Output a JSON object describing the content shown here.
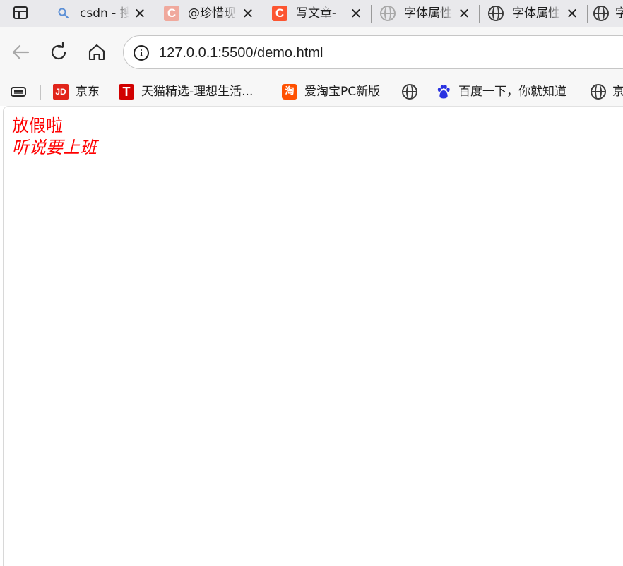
{
  "tabs": [
    {
      "title": "csdn - 搜",
      "icon": "search-icon",
      "close": "✕"
    },
    {
      "title": "@珍惜现",
      "icon": "csdn-icon",
      "close": "✕"
    },
    {
      "title": "写文章-",
      "icon": "csdn-icon",
      "close": "✕"
    },
    {
      "title": "字体属性",
      "icon": "globe-icon",
      "close": "✕"
    },
    {
      "title": "字体属性",
      "icon": "globe-icon",
      "close": "✕"
    },
    {
      "title": "字",
      "icon": "globe-icon"
    }
  ],
  "toolbar": {
    "url": "127.0.0.1:5500/demo.html",
    "info_glyph": "i"
  },
  "bookmarks": {
    "items": [
      {
        "label": "京东",
        "icon_text": "JD"
      },
      {
        "label": "天猫精选-理想生活...",
        "icon_text": "T"
      },
      {
        "label": "爱淘宝PC新版",
        "icon_text": "淘"
      },
      {
        "label": "",
        "icon": "globe-icon"
      },
      {
        "label": "百度一下，你就知道",
        "icon": "baidu-icon"
      },
      {
        "label": "京",
        "icon": "globe-icon"
      }
    ]
  },
  "content": {
    "line1": "放假啦",
    "line2": "听说要上班"
  },
  "colors": {
    "text": "#ff0000",
    "tabstrip": "#e9e9ec",
    "toolbar": "#f7f7f7",
    "csdn_light": "#f0a99d",
    "csdn_strong": "#fc5531",
    "baidu": "#2932e1"
  }
}
